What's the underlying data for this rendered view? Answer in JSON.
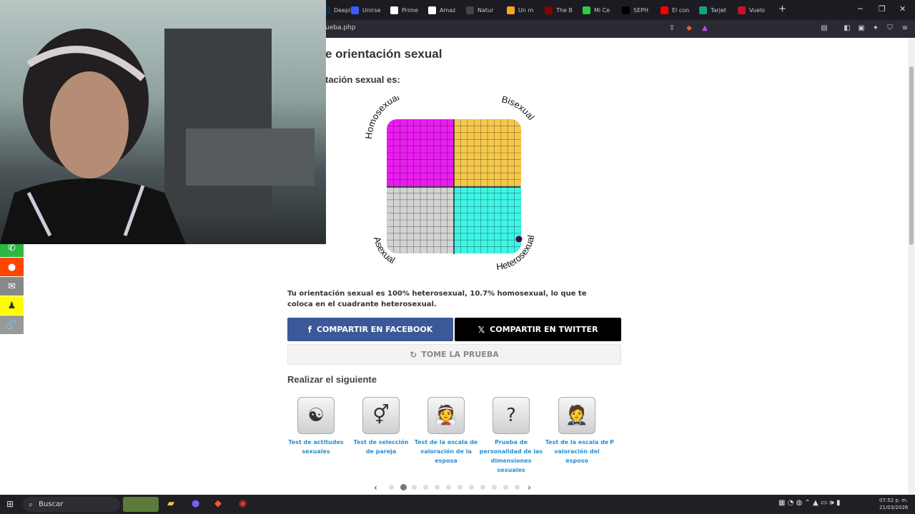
{
  "browser": {
    "tabs": [
      {
        "label": "Deepl",
        "color": "#0f2b46"
      },
      {
        "label": "Unirse",
        "color": "#3d5afe"
      },
      {
        "label": "Prime",
        "color": "#ffffff"
      },
      {
        "label": "Amaz",
        "color": "#ffffff"
      },
      {
        "label": "Natur",
        "color": "#444444"
      },
      {
        "label": "Un m",
        "color": "#f5a623"
      },
      {
        "label": "The B",
        "color": "#8b0000"
      },
      {
        "label": "Mi Ce",
        "color": "#2ecc40"
      },
      {
        "label": "SEPH",
        "color": "#000000"
      },
      {
        "label": "El con",
        "color": "#ff0000"
      },
      {
        "label": "Tarjet",
        "color": "#10a37f"
      },
      {
        "label": "Vuelo",
        "color": "#c8102e"
      }
    ],
    "new_tab": "+",
    "url": "ueba.php"
  },
  "page": {
    "title": "e orientación sexual",
    "subtitle": "tación sexual es:",
    "result_text": "Tu orientación sexual es 100% heterosexual, 10.7% homosexual, lo que te coloca en el cuadrante heterosexual.",
    "share_facebook": "COMPARTIR EN FACEBOOK",
    "share_twitter": "COMPARTIR EN TWITTER",
    "retake": "TOME LA PRUEBA",
    "next_heading": "Realizar el siguiente",
    "cards": [
      {
        "label": "Test de actitudes sexuales",
        "icon": "yin-yang-icon",
        "glyph": "☯"
      },
      {
        "label": "Test de selección de pareja",
        "icon": "gender-symbols-icon",
        "glyph": "⚥"
      },
      {
        "label": "Test de la escala de valoración de la esposa",
        "icon": "bride-icon",
        "glyph": "👰"
      },
      {
        "label": "Prueba de personalidad de las dimensiones sexuales",
        "icon": "question-mark-icon",
        "glyph": "?"
      },
      {
        "label": "Test de la escala de valoración del esposo",
        "icon": "groom-icon",
        "glyph": "🤵"
      },
      {
        "label": "P",
        "icon": "partial-card",
        "glyph": ""
      }
    ],
    "carousel": {
      "count": 12,
      "active": 1
    }
  },
  "chart_data": {
    "type": "scatter",
    "quadrant_labels": {
      "top_left": "Homosexual",
      "top_right": "Bisexual",
      "bottom_left": "Asexual",
      "bottom_right": "Heterosexual"
    },
    "quadrant_colors": {
      "top_left": "#e81ef0",
      "top_right": "#f5c84c",
      "bottom_left": "#d3d3d3",
      "bottom_right": "#3ff5e6"
    },
    "point": {
      "heterosexual": 100,
      "homosexual": 10.7
    },
    "point_color": "#4a0a40",
    "xlim": [
      0,
      100
    ],
    "ylim": [
      0,
      100
    ]
  },
  "social": [
    {
      "name": "whatsapp-icon",
      "color": "#2cb742",
      "glyph": "✆"
    },
    {
      "name": "reddit-icon",
      "color": "#ff4500",
      "glyph": "●"
    },
    {
      "name": "email-icon",
      "color": "#888888",
      "glyph": "✉"
    },
    {
      "name": "snapchat-icon",
      "color": "#fffc00",
      "glyph": "♟"
    },
    {
      "name": "link-icon",
      "color": "#999999",
      "glyph": "🔗"
    }
  ],
  "taskbar": {
    "search_label": "Buscar",
    "time": "07:52 p. m.",
    "date": "21/03/2026"
  }
}
